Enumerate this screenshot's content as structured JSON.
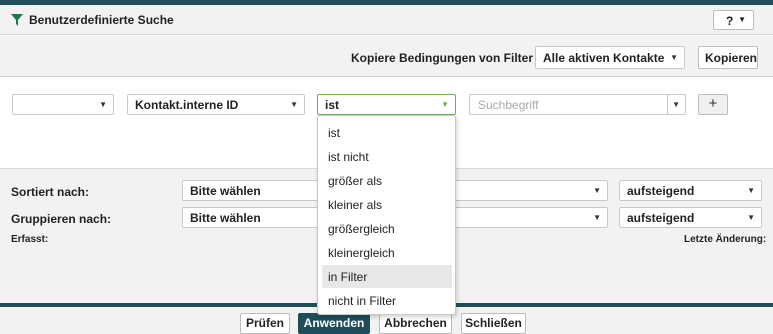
{
  "header": {
    "title": "Benutzerdefinierte Suche",
    "help_label": "?",
    "accent": "#1f4e5a",
    "funnel_color": "#1a7a45"
  },
  "copy": {
    "label": "Kopiere Bedingungen von Filter",
    "filter_select": "Alle aktiven Kontakte",
    "copy_button": "Kopieren"
  },
  "condition": {
    "field1": "",
    "field2": "Kontakt.interne ID",
    "operator": "ist",
    "search_placeholder": "Suchbegriff",
    "add_button": "+"
  },
  "operator_dropdown": {
    "items": [
      "ist",
      "ist nicht",
      "größer als",
      "kleiner als",
      "größergleich",
      "kleinergleich",
      "in Filter",
      "nicht in Filter"
    ],
    "highlighted": "in Filter"
  },
  "sort": {
    "sort_label": "Sortiert nach:",
    "sort_value": "Bitte wählen",
    "sort_order": "aufsteigend",
    "group_label": "Gruppieren nach:",
    "group_value": "Bitte wählen",
    "group_order": "aufsteigend",
    "created_label": "Erfasst:",
    "changed_label": "Letzte Änderung:"
  },
  "footer": {
    "check": "Prüfen",
    "apply": "Anwenden",
    "cancel": "Abbrechen",
    "close": "Schließen"
  }
}
